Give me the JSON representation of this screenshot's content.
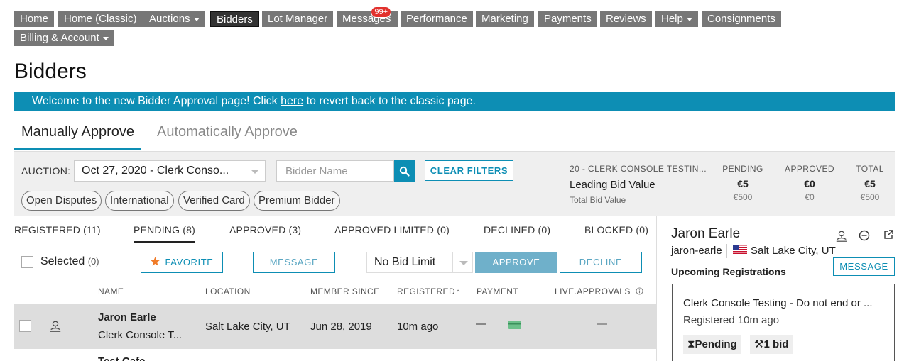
{
  "nav": {
    "items": [
      {
        "label": "Home"
      },
      {
        "label": "Home (Classic)"
      },
      {
        "label": "Auctions"
      },
      {
        "label": "Bidders"
      },
      {
        "label": "Lot Manager"
      },
      {
        "label": "Messages",
        "badge": "99+"
      },
      {
        "label": "Performance"
      },
      {
        "label": "Marketing"
      },
      {
        "label": "Payments"
      },
      {
        "label": "Reviews"
      },
      {
        "label": "Help"
      },
      {
        "label": "Consignments"
      },
      {
        "label": "Billing & Account"
      }
    ]
  },
  "page": {
    "title": "Bidders",
    "banner": {
      "before": "Welcome to the new Bidder Approval page! Click ",
      "link": "here",
      "after": " to revert back to the classic page."
    }
  },
  "tabs": {
    "manual": "Manually Approve",
    "auto": "Automatically Approve"
  },
  "filters": {
    "auction_label": "AUCTION:",
    "auction_value": "Oct 27, 2020 - Clerk Conso...",
    "bidder_placeholder": "Bidder Name",
    "clear_label": "CLEAR FILTERS",
    "pills": [
      "Open Disputes",
      "International",
      "Verified Card",
      "Premium Bidder"
    ]
  },
  "stats": {
    "auction_name": "20 - CLERK CONSOLE TESTIN...",
    "leading_label": "Leading Bid Value",
    "total_label": "Total Bid Value",
    "pending": {
      "head": "PENDING",
      "value": "€5",
      "sub": "€500"
    },
    "approved": {
      "head": "APPROVED",
      "value": "€0",
      "sub": "€0"
    },
    "total": {
      "head": "TOTAL",
      "value": "€5",
      "sub": "€500"
    }
  },
  "status_tabs": {
    "registered": {
      "label": "REGISTERED",
      "count": "(11)"
    },
    "pending": {
      "label": "PENDING",
      "count": "(8)"
    },
    "approved": {
      "label": "APPROVED",
      "count": "(3)"
    },
    "approved_limited": {
      "label": "APPROVED LIMITED",
      "count": "(0)"
    },
    "declined": {
      "label": "DECLINED",
      "count": "(0)"
    },
    "blocked": {
      "label": "BLOCKED",
      "count": "(0)"
    }
  },
  "actions": {
    "selected_label": "Selected",
    "selected_count": "(0)",
    "favorite": "FAVORITE",
    "message": "MESSAGE",
    "limit": "No Bid Limit",
    "approve": "APPROVE",
    "decline": "DECLINE"
  },
  "table": {
    "headers": {
      "name": "NAME",
      "location": "LOCATION",
      "member_since": "MEMBER SINCE",
      "registered": "REGISTERED",
      "payment": "PAYMENT",
      "live_approvals": "LIVE.APPROVALS"
    },
    "rows": [
      {
        "name": "Jaron Earle",
        "auction": "Clerk Console T...",
        "location": "Salt Lake City, UT",
        "member_since": "Jun 28, 2019",
        "registered": "10m ago",
        "payment": "—",
        "live": "—"
      },
      {
        "name": "Test Cafe"
      }
    ]
  },
  "side": {
    "name": "Jaron Earle",
    "handle": "jaron-earle",
    "location": "Salt Lake City, UT",
    "upcoming": "Upcoming Registrations",
    "message": "MESSAGE",
    "card": {
      "title": "Clerk Console Testing - Do not end or ...",
      "registered": "Registered 10m ago",
      "status": "Pending",
      "bids": "1 bid"
    }
  },
  "colors": {
    "accent": "#0d8eb4",
    "nav_bg": "#777777",
    "favorite_star": "#f07c2a",
    "badge": "#e2312d"
  }
}
